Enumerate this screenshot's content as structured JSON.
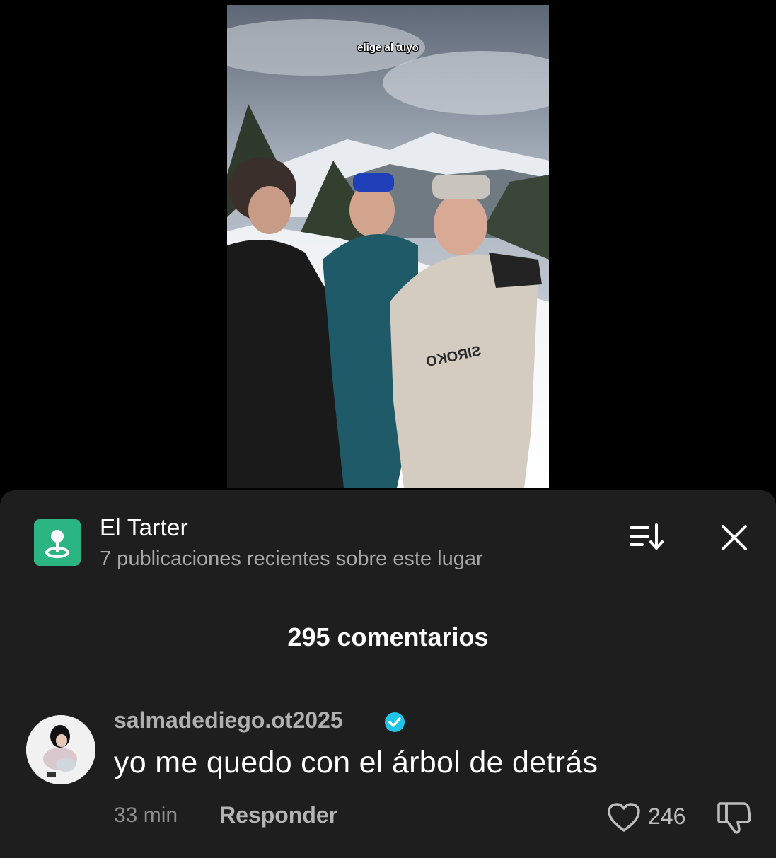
{
  "video": {
    "caption": "elige al tuyo",
    "jacket_brand": "SIROKO"
  },
  "place": {
    "name": "El Tarter",
    "subtitle": "7 publicaciones recientes sobre este lugar",
    "icon": "location-pin-icon",
    "accent_color": "#2bb582"
  },
  "header": {
    "sort_icon": "sort-icon",
    "close_icon": "close-icon"
  },
  "comments": {
    "count_label": "295 comentarios",
    "items": [
      {
        "username": "salmadediego.ot2025",
        "verified": true,
        "text": "yo me quedo con el árbol de detrás",
        "time": "33 min",
        "reply_label": "Responder",
        "likes": "246"
      }
    ]
  },
  "colors": {
    "sheet_background": "#1e1e1e",
    "verified_badge": "#20c4e8"
  }
}
